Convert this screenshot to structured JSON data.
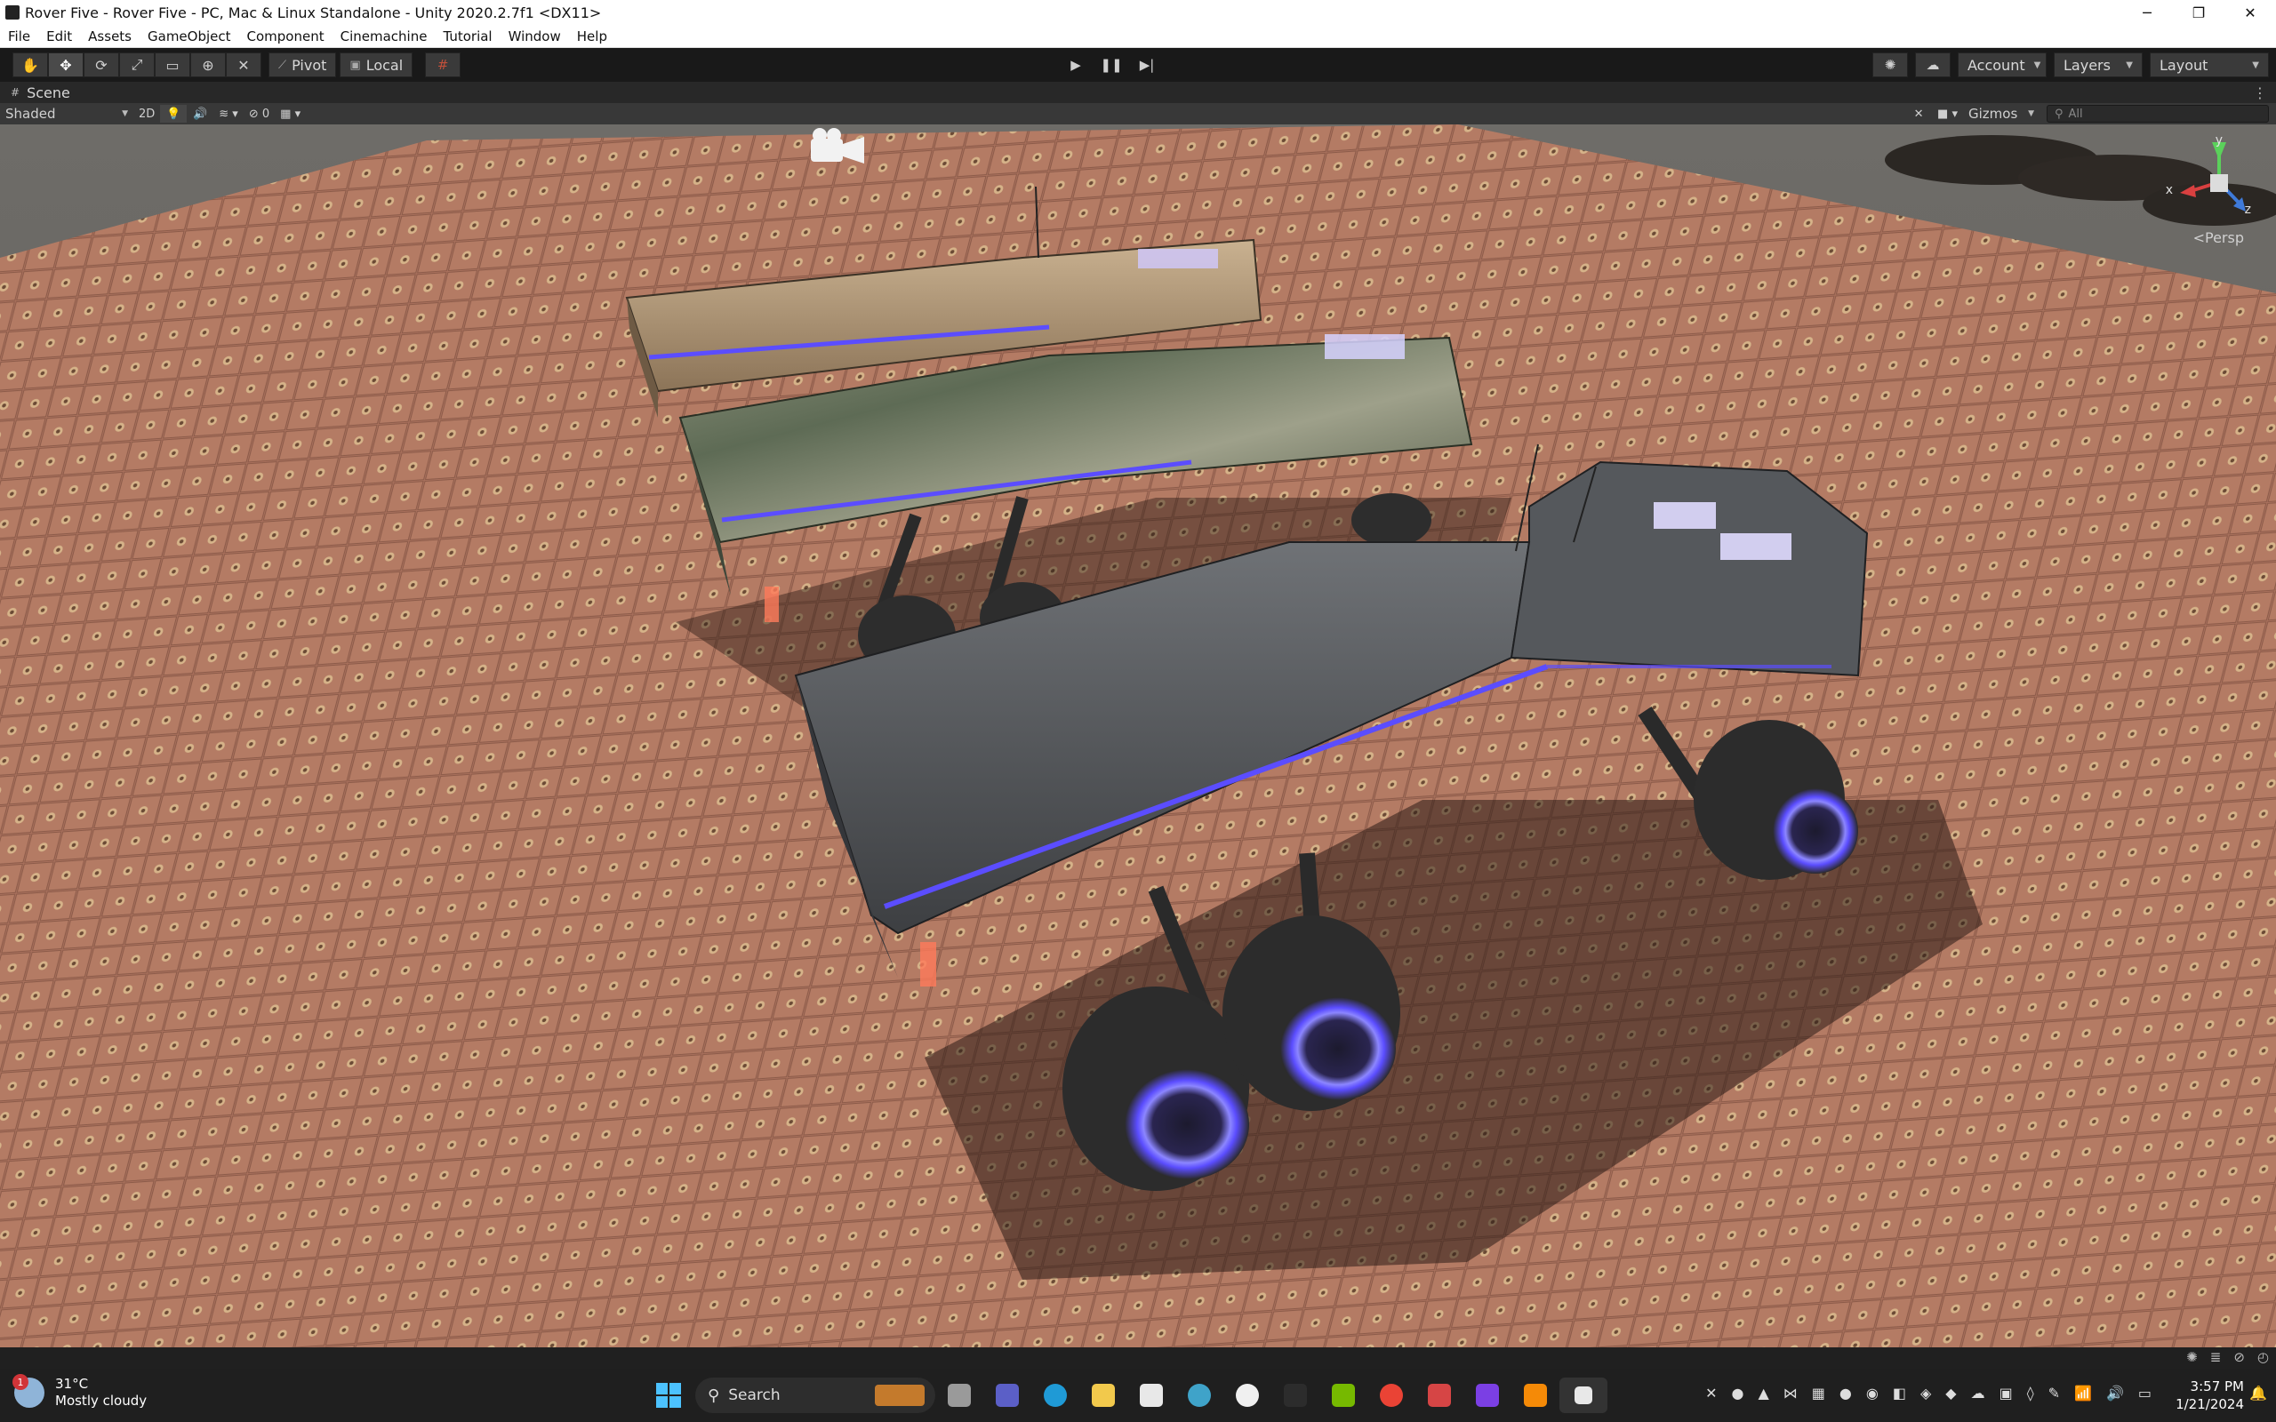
{
  "window": {
    "title": "Rover Five - Rover Five - PC, Mac & Linux Standalone - Unity 2020.2.7f1 <DX11>",
    "minimize": "─",
    "maximize": "❐",
    "close": "✕"
  },
  "menu": [
    "File",
    "Edit",
    "Assets",
    "GameObject",
    "Component",
    "Cinemachine",
    "Tutorial",
    "Window",
    "Help"
  ],
  "toolbar": {
    "pivot_label": "Pivot",
    "local_label": "Local",
    "account_label": "Account",
    "layers_label": "Layers",
    "layout_label": "Layout"
  },
  "scene_tab": {
    "label": "Scene",
    "shading_mode": "Shaded",
    "mode_2d": "2D",
    "hidden_count": "0",
    "gizmos_label": "Gizmos",
    "search_placeholder": "All",
    "projection_label": "<Persp",
    "axis_x": "x",
    "axis_y": "y",
    "axis_z": "z"
  },
  "taskbar": {
    "weather_temp": "31°C",
    "weather_desc": "Mostly cloudy",
    "weather_badge": "1",
    "search_label": "Search",
    "time": "3:57 PM",
    "date": "1/21/2024"
  },
  "colors": {
    "accent_glow": "#5b4dff",
    "tile_floor": "#a8705c"
  }
}
